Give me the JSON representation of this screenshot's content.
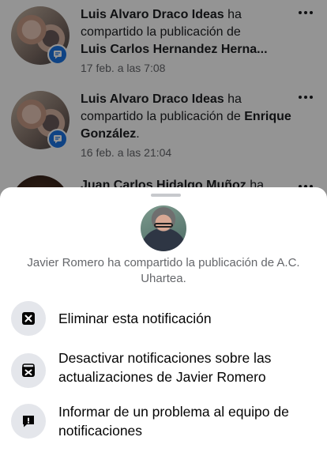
{
  "notifications": [
    {
      "actor": "Luis Alvaro Draco Ideas",
      "verb": "ha",
      "middle": "compartido la publicación de",
      "target": "Luis Carlos Hernandez Herna...",
      "time": "17 feb. a las 7:08"
    },
    {
      "actor": "Luis Alvaro Draco Ideas",
      "verb": "ha",
      "middle": "compartido la publicación de",
      "target": "Enrique González",
      "target_suffix": ".",
      "time": "16 feb. a las 21:04"
    },
    {
      "actor": "Juan Carlos Hidalgo Muñoz",
      "verb": "ha"
    }
  ],
  "sheet": {
    "title": "Javier Romero ha compartido la publicación de A.C. Uhartea.",
    "options": [
      {
        "label": "Eliminar esta notificación",
        "icon": "remove-box-icon"
      },
      {
        "label": "Desactivar notificaciones sobre las actualizaciones de Javier Romero",
        "icon": "notifications-off-icon"
      },
      {
        "label": "Informar de un problema al equipo de notificaciones",
        "icon": "report-problem-icon"
      }
    ]
  },
  "colors": {
    "accent": "#1b74e4",
    "overlay": "rgba(0,0,0,0.42)"
  }
}
